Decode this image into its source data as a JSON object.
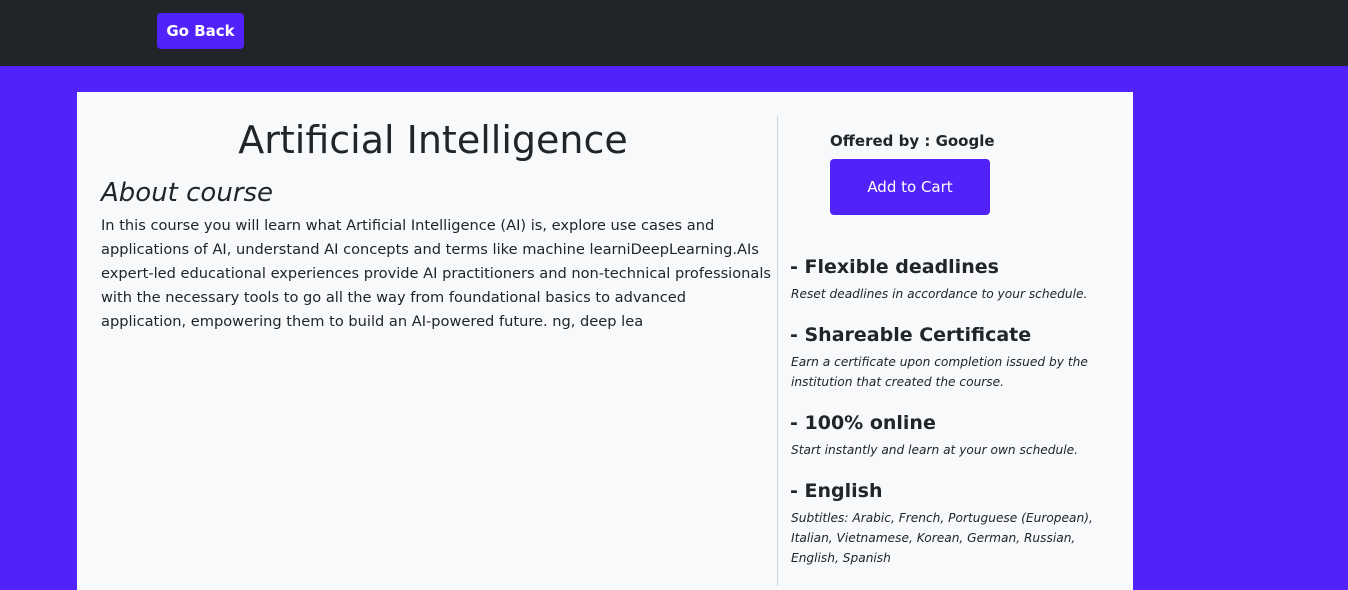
{
  "header": {
    "go_back_label": "Go Back"
  },
  "course": {
    "title": "Artificial Intelligence",
    "about_heading": "About course",
    "about_text": "In this course you will learn what Artificial Intelligence (AI) is, explore use cases and applications of AI, understand AI concepts and terms like machine learniDeepLearning.AIs expert-led educational experiences provide AI practitioners and non-technical professionals with the necessary tools to go all the way from foundational basics to advanced application, empowering them to build an AI-powered future. ng, deep lea"
  },
  "sidebar": {
    "offered_by": "Offered by : Google",
    "add_to_cart_label": "Add to Cart",
    "features": [
      {
        "title": "- Flexible deadlines",
        "description": "Reset deadlines in accordance to your schedule."
      },
      {
        "title": "- Shareable Certificate",
        "description": "Earn a certificate upon completion issued by the institution that created the course."
      },
      {
        "title": "- 100% online",
        "description": "Start instantly and learn at your own schedule."
      },
      {
        "title": "- English",
        "description": "Subtitles: Arabic, French, Portuguese (European), Italian, Vietnamese, Korean, German, Russian, English, Spanish"
      }
    ]
  },
  "colors": {
    "brand": "#5222fb",
    "topbar": "#212529",
    "card": "#f8f9fa",
    "text": "#212529"
  }
}
